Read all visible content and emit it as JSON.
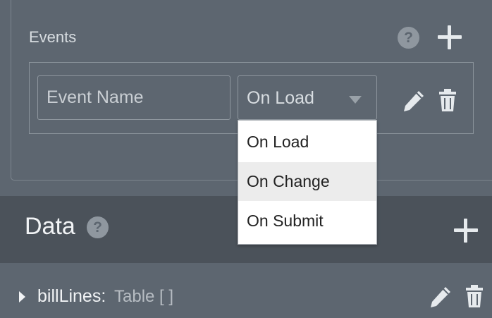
{
  "events": {
    "title": "Events",
    "help_icon": "question-circle-icon",
    "add_icon": "plus-icon",
    "name_placeholder": "Event Name",
    "selected_event": "On Load",
    "options": [
      "On Load",
      "On Change",
      "On Submit"
    ],
    "highlighted_option": "On Change",
    "edit_icon": "pencil-icon",
    "delete_icon": "trash-icon"
  },
  "data_section": {
    "title": "Data",
    "help_icon": "question-circle-icon",
    "add_icon": "plus-icon"
  },
  "data_items": [
    {
      "name": "billLines:",
      "type": "Table [ ]",
      "expand_icon": "caret-right-icon",
      "edit_icon": "pencil-icon",
      "delete_icon": "trash-icon"
    }
  ],
  "colors": {
    "panel_bg": "#5d6670",
    "band_bg": "#4b525a",
    "text_light": "#d8dde1",
    "dropdown_bg": "#ffffff",
    "dropdown_highlight": "#ececec"
  }
}
